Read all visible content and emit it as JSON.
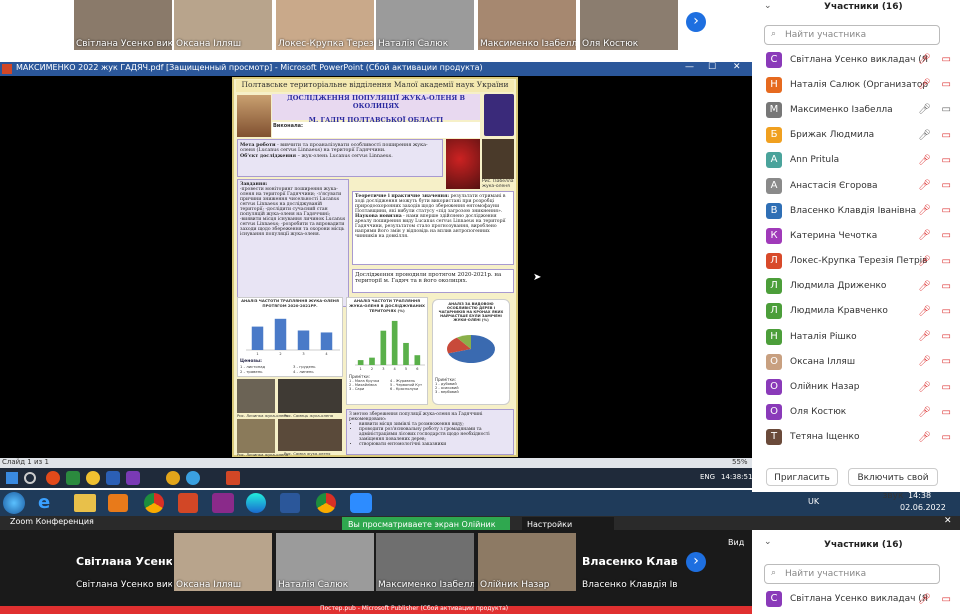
{
  "top_strip": {
    "tiles": [
      {
        "name": "Світлана Усенко викл...",
        "color": "#8a7a6a"
      },
      {
        "name": "Оксана Ілляш",
        "color": "#b8a48c"
      },
      {
        "name": "Локес-Крупка Терезія...",
        "color": "#c9a98a"
      },
      {
        "name": "Наталія Салюк",
        "color": "#9b9b9b"
      },
      {
        "name": "Максименко Ізабелла",
        "color": "#a68870"
      },
      {
        "name": "Оля Костюк",
        "color": "#8b7d6f"
      }
    ]
  },
  "ppt_window": {
    "title": "МАКСИМЕНКО 2022 жук ГАДЯЧ.pdf [Защищенный просмотр] - Microsoft PowerPoint (Сбой активации продукта)",
    "status_left": "Слайд 1 из 1",
    "zoom": "55%"
  },
  "poster": {
    "header": "Полтавське територіальне відділення Малої академії наук України",
    "title1": "ДОСЛІДЖЕННЯ ПОПУЛЯЦІЇ ЖУКА-ОЛЕНЯ В ОКОЛИЦЯХ",
    "title2": "М. ГАДІЧ ПОЛТАВСЬКОЇ ОБЛАСТІ",
    "author_label": "Виконала:",
    "goal_label": "Мета роботи",
    "goal_text": "- вивчити та проаналізувати особливості поширення жука-оленя (Lucanus cervus Linnaeus) на території Гадяччини.",
    "object_label": "Об'єкт дослідження",
    "object_text": "– жук-олень Lucanus cervus Linnaeus.",
    "tasks_label": "Завдання:",
    "tasks_text": "-провести моніторинг поширення жука-оленя на території Гадяччини; -з'ясувати причини зниження чисельності Lucanus cervus Linnaeus на досліджуваній території; -дослідити сучасний стан популяцій жука-оленя на Гадяччині; -виявити місця існування личинок Lucanus cervus Linnaeus; -розробити та впровадити заходи щодо збереження та охорони місць існування популяції жука-оленя.",
    "theory_label": "Теоретичне і практичне значення:",
    "theory_text": "результати отримані в ході дослідження можуть бути використані при розробці природоохоронних заходів щодо збереження ентомофауни Полтавщини, які вибули статусу «під загрозою зникнення».",
    "novelty_label": "Наукова новизна",
    "novelty_text": "- нами вперше здійснено дослідження ареалу поширення виду Lucanus cervus Linnaeus на території Гадяччини, результатом стало прогнозування, вироблено напрями його змін у відповідь на вплив антропогенних чинників на довкілля.",
    "period_text": "Дослідження проводили протягом 2020-2021р. на території м. Гадяч та в його околицях.",
    "fig_caption": "Рис. Ізабелла жука-оленя",
    "chart1_title": "АНАЛІЗ ЧАСТОТИ ТРАПЛЯННЯ ЖУКА-ОЛЕНЯ ПРОТЯГОМ 2020-2021РР.",
    "chart1_legend": "Ценозы:",
    "chart1_legend_items": [
      "1 - листопад",
      "2 - травень",
      "3 - грудень",
      "4 - липень"
    ],
    "chart2_title": "АНАЛІЗ ЧАСТОТИ ТРАПЛЯННЯ ЖУКА-ОЛЕНЯ В ДОСЛІДЖУВАНИХ ТЕРИТОРІЯХ (%)",
    "chart2_legend_title": "Примітки:",
    "chart2_legend_items": [
      "1 - Мала Кручка",
      "2 - Михайлівка",
      "3 - Сари",
      "4 - Журавель",
      "5 - Червоний Кут",
      "6 - Краснолуки"
    ],
    "chart3_title": "АНАЛІЗ ЗА ВИДОВОЮ ОСОБЛИВІСТЮ ДЕРЕВ І ЧАГАРНИКІВ НА КРОНАХ ЯКИХ НАЙЧАСТІШЕ БУЛИ ЗАМІЧЕНІ ЖУКИ-ОЛЕНІ (%)",
    "chart3_legend_title": "Примітки:",
    "chart3_legend_items": [
      "1 - дубовий",
      "2 - осиковий",
      "3 - вербовий"
    ],
    "photo1_caption": "Рис. Личинка жука-оленя",
    "photo2_caption": "Рис. Самець жука-оленя",
    "photo3_caption": "Рис. Личинка жука-оленя",
    "photo4_caption": "Рис. Самка жука-оленя",
    "conclusion_title": "З метою збереження популяції жука-оленя на Гадяччині рекомендовано:",
    "conclusions": [
      "виявити місця зимівлі та розмноження виду;",
      "проводити роз'яснювальну роботу з громадянами та адміністраціями лісових господарств щодо необхідності заміщення повалених дерев;",
      "створювати ентомологічні заказники"
    ]
  },
  "chart_data": [
    {
      "type": "bar",
      "title": "АНАЛІЗ ЧАСТОТИ ТРАПЛЯННЯ ЖУКА-ОЛЕНЯ ПРОТЯГОМ 2020-2021РР.",
      "categories": [
        "1",
        "2",
        "3",
        "4"
      ],
      "values": [
        60,
        80,
        50,
        45
      ],
      "ylim": [
        0,
        100
      ]
    },
    {
      "type": "bar",
      "title": "АНАЛІЗ ЧАСТОТИ ТРАПЛЯННЯ ЖУКА-ОЛЕНЯ В ДОСЛІДЖУВАНИХ ТЕРИТОРІЯХ (%)",
      "categories": [
        "1",
        "2",
        "3",
        "4",
        "5",
        "6"
      ],
      "values": [
        10,
        15,
        70,
        90,
        45,
        20
      ],
      "ylim": [
        0,
        100
      ]
    },
    {
      "type": "pie",
      "title": "АНАЛІЗ ЗА ВИДОВОЮ ОСОБЛИВІСТЮ ДЕРЕВ І ЧАГАРНИКІВ НА КРОНАХ ЯКИХ НАЙЧАСТІШЕ БУЛИ ЗАМІЧЕНІ ЖУКИ-ОЛЕНІ (%)",
      "categories": [
        "1",
        "2",
        "3"
      ],
      "values": [
        70,
        20,
        10
      ]
    }
  ],
  "inner_taskbar": {
    "lang": "ENG",
    "time": "14:38:51"
  },
  "outer_taskbar": {
    "lang": "UK",
    "time": "14:38",
    "date": "02.06.2022"
  },
  "zoom_bar": {
    "title": "Zoom Конференция",
    "sharing": "Вы просматриваете экран Олійник Назар",
    "view_settings": "Настройки просмотра",
    "view_label": "Вид"
  },
  "bottom_strip": {
    "tiles": [
      {
        "name": "Світлана Усенко викл...",
        "big": "Світлана Усенк...",
        "color": "#1a1a1a"
      },
      {
        "name": "Оксана Ілляш",
        "color": "#b8a48c"
      },
      {
        "name": "Наталія Салюк",
        "color": "#9b9b9b"
      },
      {
        "name": "Максименко Ізабелла",
        "color": "#6f6f6f"
      },
      {
        "name": "Олійник Назар",
        "color": "#8d7a64"
      },
      {
        "name": "Власенко Клавдія Іван...",
        "big": "Власенко Клав...",
        "color": "#1a1a1a"
      }
    ]
  },
  "bottom_window_title": "Постер.pub - Microsoft Publisher (Сбой активации продукта)",
  "participants": {
    "header": "Участники (16)",
    "search_placeholder": "Найти участника",
    "list": [
      {
        "initial": "С",
        "name": "Світлана Усенко викладач (Я)",
        "color": "#8a3ab9",
        "mic": "off",
        "cam": "off"
      },
      {
        "initial": "Н",
        "name": "Наталія Салюк (Организатор)",
        "color": "#e66a1f",
        "mic": "off",
        "cam": "off"
      },
      {
        "initial": "М",
        "name": "Максименко Ізабелла",
        "color": "#777777",
        "mic": "on",
        "cam": "on"
      },
      {
        "initial": "Б",
        "name": "Брижак Людмила",
        "color": "#f0a020",
        "mic": "on",
        "cam": "off"
      },
      {
        "initial": "А",
        "name": "Ann Pritula",
        "color": "#4aa39b",
        "mic": "off",
        "cam": "off"
      },
      {
        "initial": "А",
        "name": "Анастасія Єгорова",
        "color": "#8a8a8a",
        "mic": "off",
        "cam": "off"
      },
      {
        "initial": "В",
        "name": "Власенко Клавдія Іванівна",
        "color": "#2f6fb5",
        "mic": "off",
        "cam": "off"
      },
      {
        "initial": "К",
        "name": "Катерина Чечотка",
        "color": "#a03ab9",
        "mic": "off",
        "cam": "off"
      },
      {
        "initial": "Л",
        "name": "Локес-Крупка Терезія Петрівна",
        "color": "#d84a2a",
        "mic": "off",
        "cam": "off"
      },
      {
        "initial": "Л",
        "name": "Людмила Дриженко",
        "color": "#4c9e3a",
        "mic": "off",
        "cam": "off"
      },
      {
        "initial": "Л",
        "name": "Людмила Кравченко",
        "color": "#4c9e3a",
        "mic": "off",
        "cam": "off"
      },
      {
        "initial": "Н",
        "name": "Наталія Рішко",
        "color": "#4c9e3a",
        "mic": "off",
        "cam": "off"
      },
      {
        "initial": "О",
        "name": "Оксана Ілляш",
        "color": "#c8a080",
        "mic": "off",
        "cam": "off"
      },
      {
        "initial": "О",
        "name": "Олійник Назар",
        "color": "#8a3ab9",
        "mic": "off",
        "cam": "off"
      },
      {
        "initial": "О",
        "name": "Оля Костюк",
        "color": "#8a3ab9",
        "mic": "off",
        "cam": "off"
      },
      {
        "initial": "Т",
        "name": "Тетяна Іщенко",
        "color": "#6a4a3a",
        "mic": "off",
        "cam": "off"
      }
    ],
    "invite": "Пригласить",
    "unmute": "Включить свой звук"
  },
  "participants2": {
    "header": "Участники (16)",
    "search_placeholder": "Найти участника",
    "first": {
      "initial": "С",
      "name": "Світлана Усенко викладач (Я)",
      "color": "#8a3ab9"
    }
  }
}
